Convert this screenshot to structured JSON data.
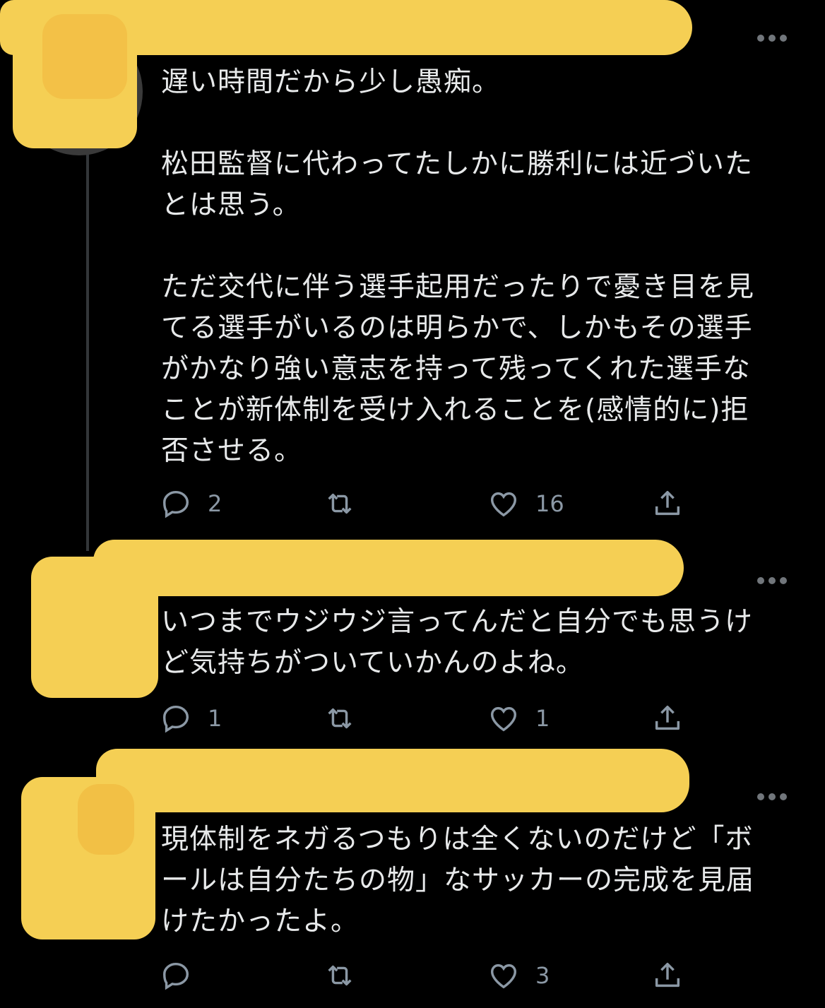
{
  "tweets": [
    {
      "text": "遅い時間だから少し愚痴。\n\n松田監督に代わってたしかに勝利には近づいた\nとは思う。\n\nただ交代に伴う選手起用だったりで憂き目を見\nてる選手がいるのは明らかで、しかもその選手\nがかなり強い意志を持って残ってくれた選手な\nことが新体制を受け入れることを(感情的に)拒\n否させる。",
      "reply_count": "2",
      "retweet_count": "",
      "like_count": "16"
    },
    {
      "text": "いつまでウジウジ言ってんだと自分でも思うけ\nど気持ちがついていかんのよね。",
      "reply_count": "1",
      "retweet_count": "",
      "like_count": "1"
    },
    {
      "text": "現体制をネガるつもりは全くないのだけど「ボ\nールは自分たちの物」なサッカーの完成を見届\nけたかったよ。",
      "reply_count": "",
      "retweet_count": "",
      "like_count": "3"
    }
  ],
  "icons": [
    "more-icon",
    "reply-icon",
    "retweet-icon",
    "like-icon",
    "share-icon"
  ],
  "colors": {
    "background": "#000000",
    "text": "#e7e9ea",
    "icon": "#8b98a5",
    "redaction": "#f5cf54"
  }
}
